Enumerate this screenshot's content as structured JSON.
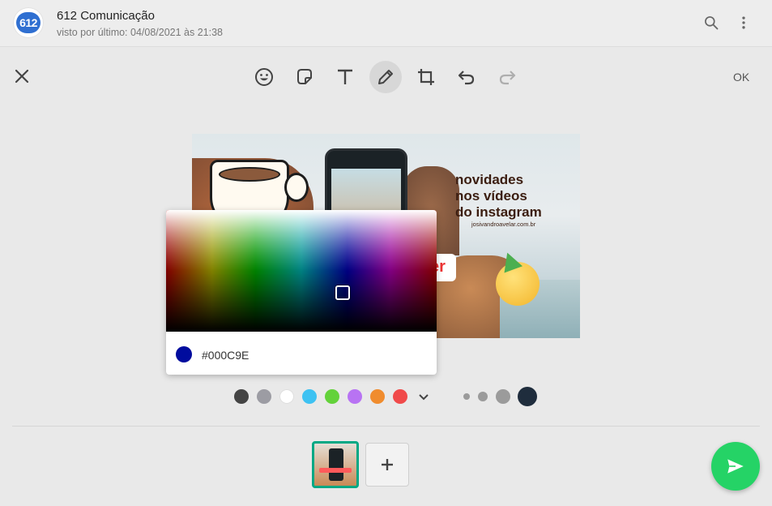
{
  "header": {
    "avatar_text": "612",
    "contact_name": "612 Comunicação",
    "status": "visto por último: 04/08/2021 às 21:38",
    "icons": [
      "search-icon",
      "menu-icon"
    ]
  },
  "toolbar": {
    "close_icon": "close-icon",
    "tools": [
      "emoji-icon",
      "sticker-icon",
      "text-icon",
      "pencil-icon",
      "crop-icon",
      "undo-icon",
      "redo-icon"
    ],
    "active_tool": "pencil-icon",
    "ok_label": "OK"
  },
  "image": {
    "headline": [
      "novidades",
      "nos vídeos",
      "do instagram"
    ],
    "site": "josivandroavelar.com.br",
    "button_fragment": "er"
  },
  "color_picker": {
    "hex": "#000C9E",
    "current_color": "#000C9E"
  },
  "palette": {
    "colors": [
      "#444444",
      "#9c9ca3",
      "#ffffff",
      "#3ec2f2",
      "#63d23a",
      "#b873f3",
      "#f08c2e",
      "#f04a4a"
    ],
    "more_icon": "chevron-down-icon",
    "brush_sizes": [
      "xs",
      "s",
      "m",
      "l"
    ],
    "selected_size": "l"
  },
  "bottom": {
    "add_icon": "plus-icon",
    "send_icon": "send-icon",
    "accent": "#25d366"
  }
}
